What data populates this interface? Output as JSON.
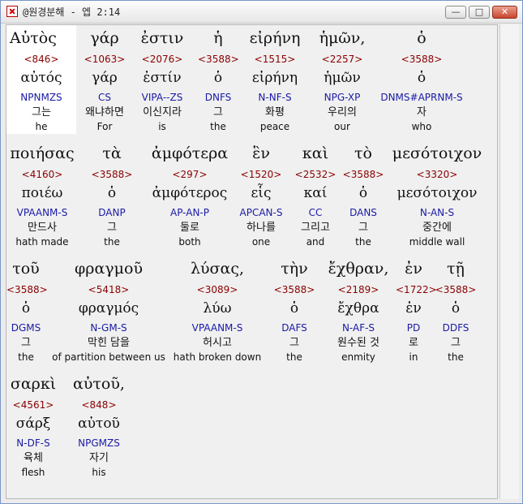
{
  "window": {
    "title": "@원경분해 - 엡 2:14",
    "min_label": "—",
    "max_label": "□",
    "close_label": "✕"
  },
  "colors": {
    "strong": "#8b0000",
    "parse": "#1a1aa6",
    "highlight": "#ffffff"
  },
  "rows": [
    {
      "words": [
        {
          "greek": "Αὐτὸς",
          "strong": "<846>",
          "lemma": "αὐτός",
          "parse": "NPNMZS",
          "korean": "그는",
          "english": "he"
        },
        {
          "greek": "γάρ",
          "strong": "<1063>",
          "lemma": "γάρ",
          "parse": "CS",
          "korean": "왜냐하면",
          "english": "For"
        },
        {
          "greek": "ἐστιν",
          "strong": "<2076>",
          "lemma": "ἐστίν",
          "parse": "VIPA--ZS",
          "korean": "이신지라",
          "english": "is"
        },
        {
          "greek": "ἡ",
          "strong": "<3588>",
          "lemma": "ὁ",
          "parse": "DNFS",
          "korean": "그",
          "english": "the"
        },
        {
          "greek": "εἰρήνη",
          "strong": "<1515>",
          "lemma": "εἰρήνη",
          "parse": "N-NF-S",
          "korean": "화평",
          "english": "peace"
        },
        {
          "greek": "ἡμῶν,",
          "strong": "<2257>",
          "lemma": "ἡμῶν",
          "parse": "NPG-XP",
          "korean": "우리의",
          "english": "our"
        },
        {
          "greek": "ὁ",
          "strong": "<3588>",
          "lemma": "ὁ",
          "parse": "DNMS#APRNM-S",
          "korean": "자",
          "english": "who"
        }
      ]
    },
    {
      "words": [
        {
          "greek": "ποιήσας",
          "strong": "<4160>",
          "lemma": "ποιέω",
          "parse": "VPAANM-S",
          "korean": "만드사",
          "english": "hath made"
        },
        {
          "greek": "τὰ",
          "strong": "<3588>",
          "lemma": "ὁ",
          "parse": "DANP",
          "korean": "그",
          "english": "the"
        },
        {
          "greek": "ἀμφότερα",
          "strong": "<297>",
          "lemma": "ἀμφότερος",
          "parse": "AP-AN-P",
          "korean": "둘로",
          "english": "both"
        },
        {
          "greek": "ἓν",
          "strong": "<1520>",
          "lemma": "εἷς",
          "parse": "APCAN-S",
          "korean": "하나를",
          "english": "one"
        },
        {
          "greek": "καὶ",
          "strong": "<2532>",
          "lemma": "καί",
          "parse": "CC",
          "korean": "그리고",
          "english": "and"
        },
        {
          "greek": "τὸ",
          "strong": "<3588>",
          "lemma": "ὁ",
          "parse": "DANS",
          "korean": "그",
          "english": "the"
        },
        {
          "greek": "μεσότοιχον",
          "strong": "<3320>",
          "lemma": "μεσότοιχον",
          "parse": "N-AN-S",
          "korean": "중간에",
          "english": "middle wall"
        }
      ]
    },
    {
      "words": [
        {
          "greek": "τοῦ",
          "strong": "<3588>",
          "lemma": "ὁ",
          "parse": "DGMS",
          "korean": "그",
          "english": "the"
        },
        {
          "greek": "φραγμοῦ",
          "strong": "<5418>",
          "lemma": "φραγμός",
          "parse": "N-GM-S",
          "korean": "막힌 담을",
          "english": "of partition between us"
        },
        {
          "greek": "λύσας,",
          "strong": "<3089>",
          "lemma": "λύω",
          "parse": "VPAANM-S",
          "korean": "허시고",
          "english": "hath broken down"
        },
        {
          "greek": "τὴν",
          "strong": "<3588>",
          "lemma": "ὁ",
          "parse": "DAFS",
          "korean": "그",
          "english": "the"
        },
        {
          "greek": "ἔχθραν,",
          "strong": "<2189>",
          "lemma": "ἔχθρα",
          "parse": "N-AF-S",
          "korean": "원수된 것",
          "english": "enmity"
        },
        {
          "greek": "ἐν",
          "strong": "<1722>",
          "lemma": "ἐν",
          "parse": "PD",
          "korean": "로",
          "english": "in"
        },
        {
          "greek": "τῇ",
          "strong": "<3588>",
          "lemma": "ὁ",
          "parse": "DDFS",
          "korean": "그",
          "english": "the"
        }
      ]
    },
    {
      "words": [
        {
          "greek": "σαρκὶ",
          "strong": "<4561>",
          "lemma": "σάρξ",
          "parse": "N-DF-S",
          "korean": "육체",
          "english": "flesh"
        },
        {
          "greek": "αὐτοῦ,",
          "strong": "<848>",
          "lemma": "αὐτοῦ",
          "parse": "NPGMZS",
          "korean": "자기",
          "english": "his"
        }
      ]
    }
  ]
}
